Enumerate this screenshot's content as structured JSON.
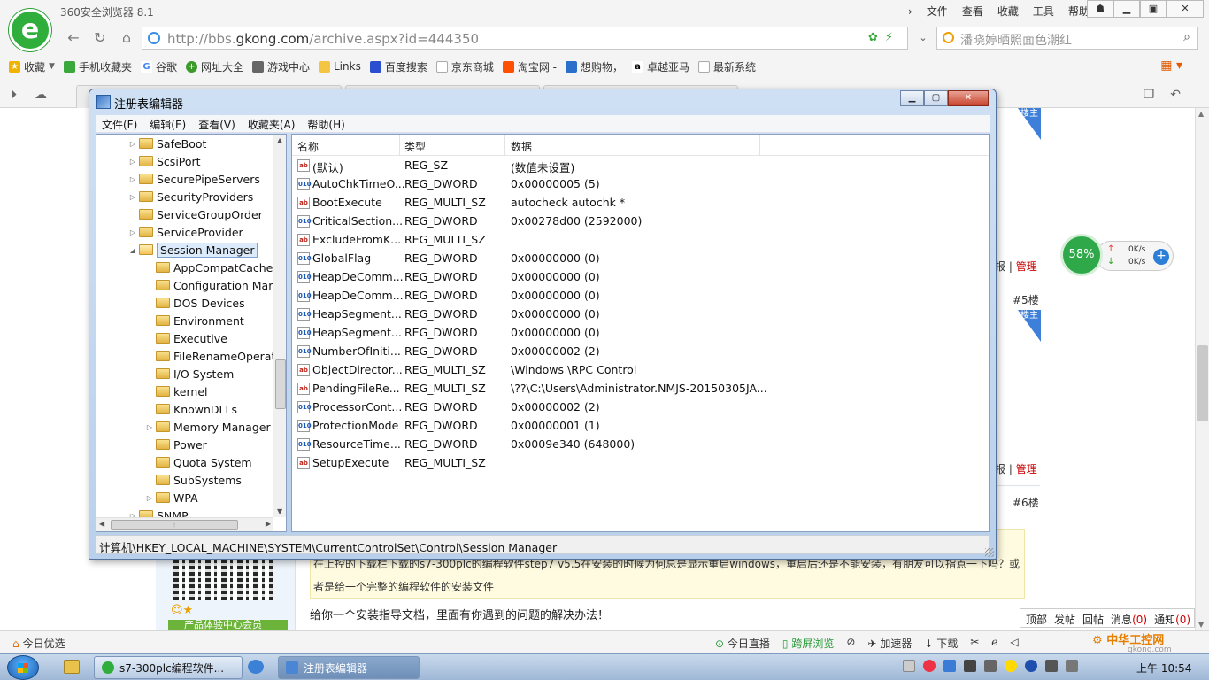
{
  "browser": {
    "app_title": "360安全浏览器 8.1",
    "menu": [
      "文件",
      "查看",
      "收藏",
      "工具",
      "帮助"
    ],
    "address_url_prefix": "http://bbs.",
    "address_url_domain": "gkong.com",
    "address_url_suffix": "/archive.aspx?id=444350",
    "search_placeholder": "潘晓婷晒照面色潮红",
    "bookmarks": [
      "收藏",
      "手机收藏夹",
      "谷歌",
      "网址大全",
      "游戏中心",
      "Links",
      "百度搜索",
      "京东商城",
      "淘宝网 -",
      "想购物，",
      "卓越亚马",
      "最新系统"
    ]
  },
  "webpage": {
    "floors": [
      "#5楼",
      "#6楼"
    ],
    "ribbon": "楼主",
    "report_label": "报",
    "manage_label": "管理",
    "quote_text": "在上控的下载栏下载的s7-300plc的编程软件step7 v5.5在安装的时候为何总是显示重启windows，重启后还是不能安装，有朋友可以指点一下吗？或者是给一个完整的编程软件的安装文件",
    "reply_text": "给你一个安装指导文档，里面有你遇到的问题的解决办法！",
    "member_badge": "产品体验中心会员",
    "quick_bar": [
      {
        "label": "顶部",
        "count": ""
      },
      {
        "label": "发帖",
        "count": ""
      },
      {
        "label": "回帖",
        "count": ""
      },
      {
        "label": "消息",
        "count": "(0)"
      },
      {
        "label": "通知",
        "count": "(0)"
      }
    ]
  },
  "speed_widget": {
    "percent": "58%",
    "up": "0K/s",
    "down": "0K/s"
  },
  "status_bar": {
    "today": "今日优选",
    "items": [
      "今日直播",
      "跨屏浏览",
      "",
      "加速器",
      "下载"
    ]
  },
  "watermark": {
    "brand": "中华工控网",
    "domain": "gkong.com"
  },
  "taskbar": {
    "buttons": [
      "s7-300plc编程软件...",
      "注册表编辑器"
    ],
    "clock": "上午 10:54"
  },
  "regedit": {
    "title": "注册表编辑器",
    "menu": [
      "文件(F)",
      "编辑(E)",
      "查看(V)",
      "收藏夹(A)",
      "帮助(H)"
    ],
    "tree": [
      {
        "label": "SafeBoot",
        "level": 0,
        "expander": "▷"
      },
      {
        "label": "ScsiPort",
        "level": 0,
        "expander": "▷"
      },
      {
        "label": "SecurePipeServers",
        "level": 0,
        "expander": "▷"
      },
      {
        "label": "SecurityProviders",
        "level": 0,
        "expander": "▷"
      },
      {
        "label": "ServiceGroupOrder",
        "level": 0,
        "expander": ""
      },
      {
        "label": "ServiceProvider",
        "level": 0,
        "expander": "▷"
      },
      {
        "label": "Session Manager",
        "level": 0,
        "expander": "◢",
        "selected": true
      },
      {
        "label": "AppCompatCache",
        "level": 1,
        "expander": ""
      },
      {
        "label": "Configuration Mar",
        "level": 1,
        "expander": ""
      },
      {
        "label": "DOS Devices",
        "level": 1,
        "expander": ""
      },
      {
        "label": "Environment",
        "level": 1,
        "expander": ""
      },
      {
        "label": "Executive",
        "level": 1,
        "expander": ""
      },
      {
        "label": "FileRenameOperat",
        "level": 1,
        "expander": ""
      },
      {
        "label": "I/O System",
        "level": 1,
        "expander": ""
      },
      {
        "label": "kernel",
        "level": 1,
        "expander": ""
      },
      {
        "label": "KnownDLLs",
        "level": 1,
        "expander": ""
      },
      {
        "label": "Memory Manager",
        "level": 1,
        "expander": "▷"
      },
      {
        "label": "Power",
        "level": 1,
        "expander": ""
      },
      {
        "label": "Quota System",
        "level": 1,
        "expander": ""
      },
      {
        "label": "SubSystems",
        "level": 1,
        "expander": ""
      },
      {
        "label": "WPA",
        "level": 1,
        "expander": "▷"
      },
      {
        "label": "SNMP",
        "level": 0,
        "expander": "▷"
      }
    ],
    "columns": [
      "名称",
      "类型",
      "数据"
    ],
    "values": [
      {
        "name": "(默认)",
        "type": "REG_SZ",
        "data": "(数值未设置)",
        "kind": "sz"
      },
      {
        "name": "AutoChkTimeO...",
        "type": "REG_DWORD",
        "data": "0x00000005 (5)",
        "kind": "bin"
      },
      {
        "name": "BootExecute",
        "type": "REG_MULTI_SZ",
        "data": "autocheck autochk *",
        "kind": "sz"
      },
      {
        "name": "CriticalSection...",
        "type": "REG_DWORD",
        "data": "0x00278d00 (2592000)",
        "kind": "bin"
      },
      {
        "name": "ExcludeFromK...",
        "type": "REG_MULTI_SZ",
        "data": "",
        "kind": "sz"
      },
      {
        "name": "GlobalFlag",
        "type": "REG_DWORD",
        "data": "0x00000000 (0)",
        "kind": "bin"
      },
      {
        "name": "HeapDeComm...",
        "type": "REG_DWORD",
        "data": "0x00000000 (0)",
        "kind": "bin"
      },
      {
        "name": "HeapDeComm...",
        "type": "REG_DWORD",
        "data": "0x00000000 (0)",
        "kind": "bin"
      },
      {
        "name": "HeapSegment...",
        "type": "REG_DWORD",
        "data": "0x00000000 (0)",
        "kind": "bin"
      },
      {
        "name": "HeapSegment...",
        "type": "REG_DWORD",
        "data": "0x00000000 (0)",
        "kind": "bin"
      },
      {
        "name": "NumberOfIniti...",
        "type": "REG_DWORD",
        "data": "0x00000002 (2)",
        "kind": "bin"
      },
      {
        "name": "ObjectDirector...",
        "type": "REG_MULTI_SZ",
        "data": "\\Windows \\RPC Control",
        "kind": "sz"
      },
      {
        "name": "PendingFileRe...",
        "type": "REG_MULTI_SZ",
        "data": "\\??\\C:\\Users\\Administrator.NMJS-20150305JA...",
        "kind": "sz"
      },
      {
        "name": "ProcessorCont...",
        "type": "REG_DWORD",
        "data": "0x00000002 (2)",
        "kind": "bin"
      },
      {
        "name": "ProtectionMode",
        "type": "REG_DWORD",
        "data": "0x00000001 (1)",
        "kind": "bin"
      },
      {
        "name": "ResourceTime...",
        "type": "REG_DWORD",
        "data": "0x0009e340 (648000)",
        "kind": "bin"
      },
      {
        "name": "SetupExecute",
        "type": "REG_MULTI_SZ",
        "data": "",
        "kind": "sz"
      }
    ],
    "status_path": "计算机\\HKEY_LOCAL_MACHINE\\SYSTEM\\CurrentControlSet\\Control\\Session Manager"
  }
}
